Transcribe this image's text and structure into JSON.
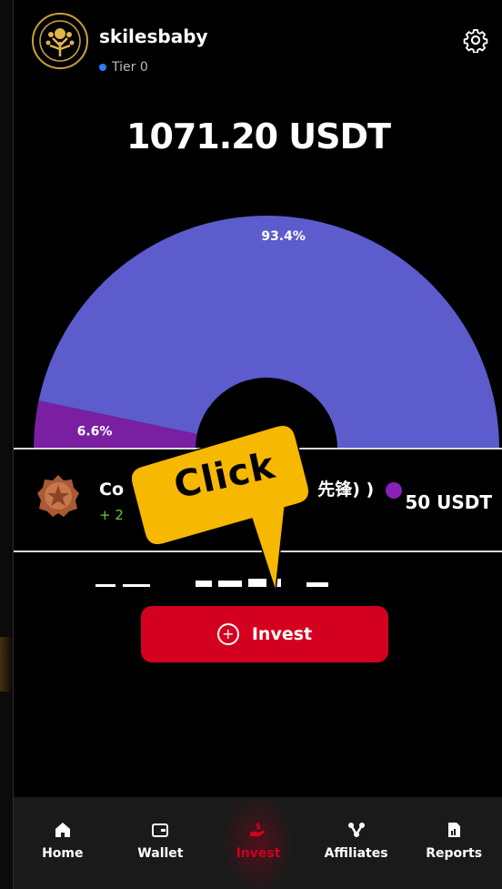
{
  "user": {
    "username": "skilesbaby",
    "tier": "Tier 0"
  },
  "balance": "1071.20 USDT",
  "chart_data": {
    "type": "pie",
    "categories": [
      "",
      ""
    ],
    "values": [
      93.4,
      6.6
    ],
    "labels": [
      "93.4%",
      "6.6%"
    ],
    "colors": [
      "#5c5ccc",
      "#7a1fa2"
    ]
  },
  "item": {
    "title_prefix": "Co",
    "title_suffix": "先锋) )",
    "subtitle": "+ 2",
    "value": "50 USDT",
    "dot_color": "#8a20b8"
  },
  "callout": {
    "text": "Click",
    "color": "#f6b800"
  },
  "invest_button": {
    "label": "Invest",
    "color": "#d4001f"
  },
  "nav": [
    {
      "label": "Home",
      "icon": "home-icon"
    },
    {
      "label": "Wallet",
      "icon": "wallet-icon"
    },
    {
      "label": "Invest",
      "icon": "invest-icon",
      "active": true
    },
    {
      "label": "Affiliates",
      "icon": "affiliates-icon"
    },
    {
      "label": "Reports",
      "icon": "reports-icon"
    }
  ]
}
